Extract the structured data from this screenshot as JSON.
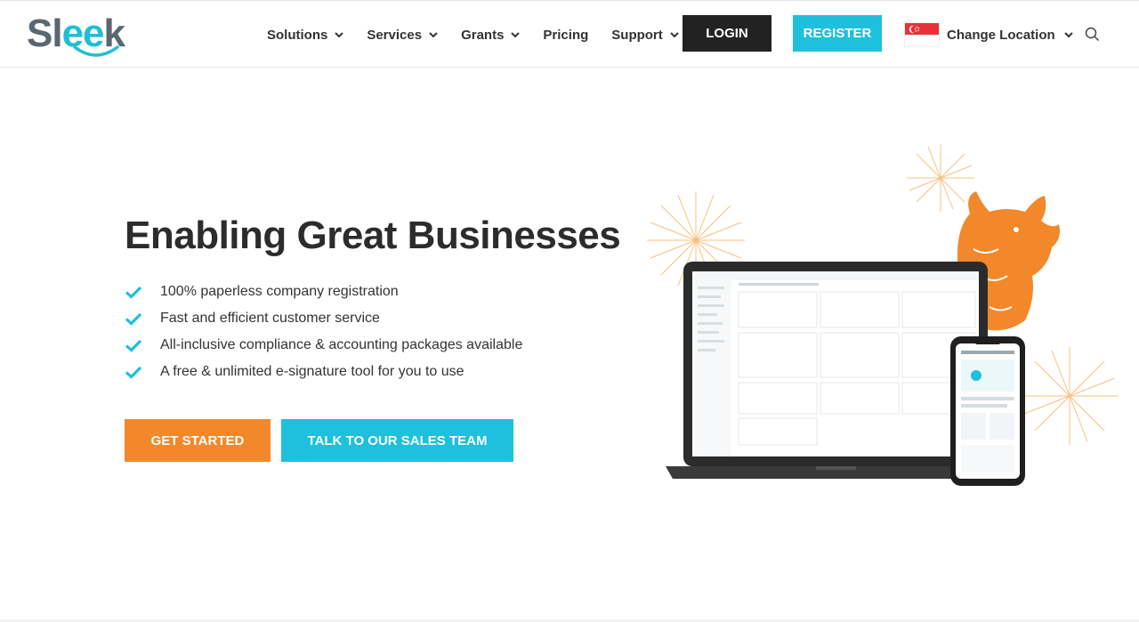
{
  "header": {
    "logo_text": "Sleek",
    "nav": [
      {
        "label": "Solutions",
        "dropdown": true
      },
      {
        "label": "Services",
        "dropdown": true
      },
      {
        "label": "Grants",
        "dropdown": true
      },
      {
        "label": "Pricing",
        "dropdown": false
      },
      {
        "label": "Support",
        "dropdown": true
      }
    ],
    "login_label": "LOGIN",
    "register_label": "REGISTER",
    "location_label": "Change Location",
    "location_flag": "singapore-flag-icon",
    "search_icon": "search-icon"
  },
  "hero": {
    "title": "Enabling Great Businesses",
    "features": [
      "100% paperless company registration",
      "Fast and efficient customer service",
      "All-inclusive compliance & accounting packages available",
      "A free & unlimited e-signature tool for you to use"
    ],
    "cta_primary": "GET STARTED",
    "cta_secondary": "TALK TO OUR SALES TEAM",
    "illustration": "laptop-phone-dashboard-with-ox-and-fireworks"
  },
  "colors": {
    "brand_cyan": "#1ec0dd",
    "brand_orange": "#f2882a",
    "dark": "#222222",
    "check": "#1ec0dd"
  }
}
